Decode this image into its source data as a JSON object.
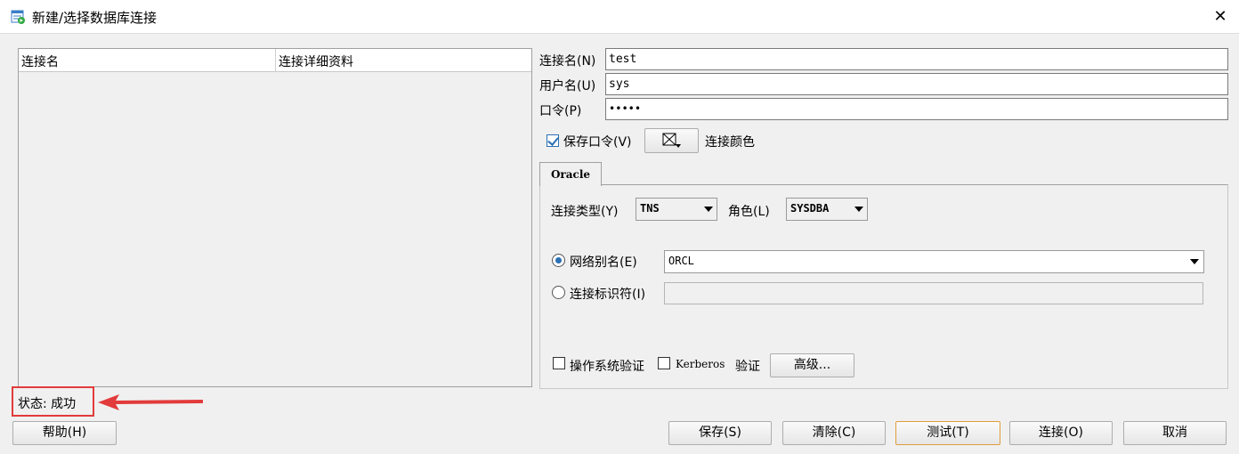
{
  "window": {
    "title": "新建/选择数据库连接",
    "close_glyph": "✕"
  },
  "connection_list": {
    "headers": [
      "连接名",
      "连接详细资料"
    ]
  },
  "form": {
    "conn_name_label": "连接名(N)",
    "conn_name_value": "test",
    "username_label": "用户名(U)",
    "username_value": "sys",
    "password_label": "口令(P)",
    "password_value": "•••••",
    "save_password_label": "保存口令(V)",
    "save_password_checked": true,
    "conn_color_label": "连接颜色"
  },
  "tabs": [
    {
      "label": "Oracle",
      "active": true
    }
  ],
  "oracle": {
    "conn_type_label": "连接类型(Y)",
    "conn_type_value": "TNS",
    "role_label": "角色(L)",
    "role_value": "SYSDBA",
    "network_alias_label": "网络别名(E)",
    "network_alias_value": "ORCL",
    "network_alias_selected": true,
    "conn_identifier_label": "连接标识符(I)",
    "conn_identifier_value": "",
    "os_auth_label": "操作系统验证",
    "kerberos_label": "Kerberos",
    "kerberos_suffix": "验证",
    "advanced_label": "高级..."
  },
  "status": {
    "text": "状态: 成功"
  },
  "buttons": {
    "help": "帮助(H)",
    "save": "保存(S)",
    "clear": "清除(C)",
    "test": "测试(T)",
    "connect": "连接(O)",
    "cancel": "取消"
  },
  "colors": {
    "annotation_red": "#e23b3b",
    "accent_blue": "#2a6fb4",
    "focus_orange": "#e09d3d"
  }
}
